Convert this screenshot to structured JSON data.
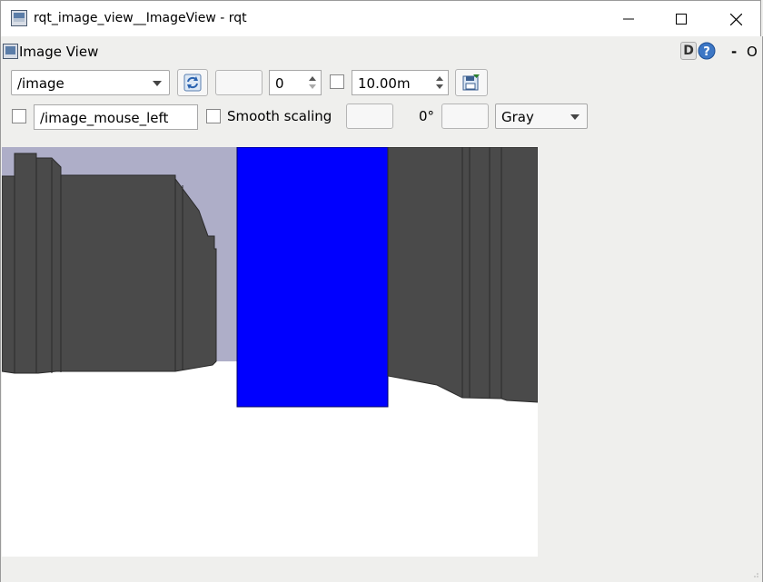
{
  "window": {
    "title": "rqt_image_view__ImageView - rqt",
    "minimize_icon": "minimize-icon",
    "maximize_icon": "maximize-icon",
    "close_icon": "close-icon"
  },
  "plugin": {
    "title": "Image View",
    "d_label": "D",
    "help_icon": "help-icon",
    "dash_label": "-",
    "o_label": "O"
  },
  "toolbar": {
    "topic": "/image",
    "refresh_icon": "refresh-icon",
    "value_spin": "0",
    "max_range": "10.00m",
    "save_icon": "save-icon"
  },
  "toolbar2": {
    "mouse_topic": "/image_mouse_left",
    "smooth_scaling_label": "Smooth scaling",
    "rotation_label": "0°",
    "colormap": "Gray"
  },
  "colors": {
    "sky": "#aeaec8",
    "wall": "#4a4a4a",
    "blue_object": "#0000ff",
    "floor": "#ffffff"
  }
}
